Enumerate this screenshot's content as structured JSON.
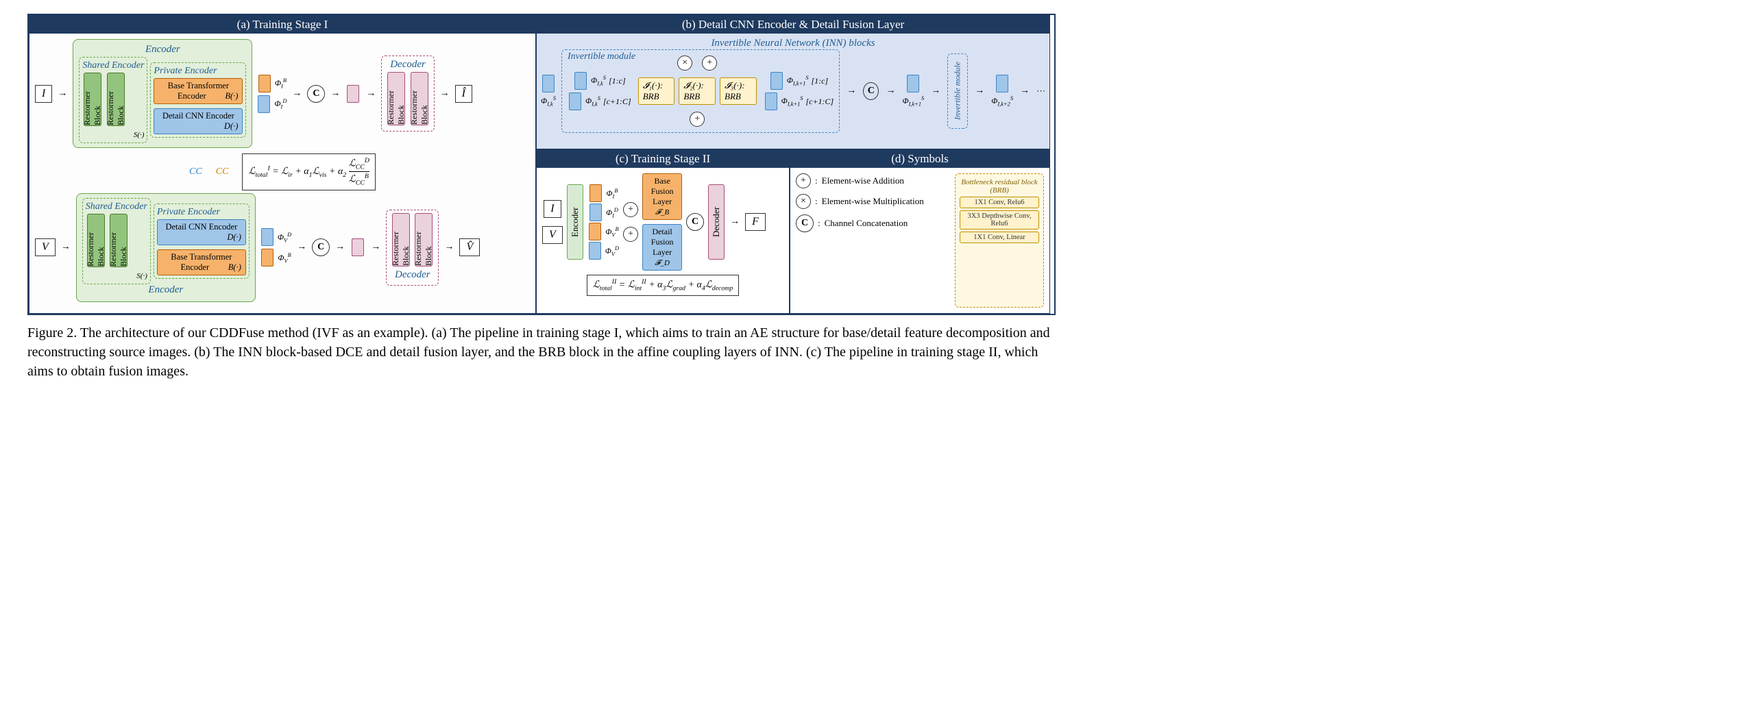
{
  "panels": {
    "a": {
      "title": "(a) Training Stage I",
      "encoder_label": "Encoder",
      "shared_encoder_label": "Shared Encoder",
      "private_encoder_label": "Private Encoder",
      "restormer": "Restormer Block",
      "bte": "Base Transformer Encoder",
      "bte_fn": "B(·)",
      "dce": "Detail CNN Encoder",
      "dce_fn": "D(·)",
      "shared_fn": "S(·)",
      "decoder_label": "Decoder",
      "input_I": "I",
      "input_V": "V",
      "output_Ihat": "Î",
      "output_Vhat": "V̂",
      "phi_B_I": "Φ_I^B",
      "phi_D_I": "Φ_I^D",
      "phi_B_V": "Φ_V^B",
      "phi_D_V": "Φ_V^D",
      "cc_label": "CC",
      "loss_I": "ℒ_total^I = ℒ_ir + α₁ℒ_vis + α₂ (ℒ_CC^D / ℒ_CC^B)"
    },
    "b": {
      "title": "(b) Detail CNN Encoder & Detail Fusion Layer",
      "inn_title": "Invertible Neural Network (INN) blocks",
      "inv_module": "Invertible module",
      "phi_in": "Φ_{I,k}^S",
      "phi_mid": "Φ_{I,k+1}^S",
      "phi_out": "Φ_{I,k+2}^S",
      "slice_top": "[1:c]",
      "slice_bot": "[c+1:C]",
      "brb1": "𝓘₁(·): BRB",
      "brb2": "𝓘₂(·): BRB",
      "brb3": "𝓘₃(·): BRB",
      "dots": "···"
    },
    "c": {
      "title": "(c) Training Stage II",
      "input_I": "I",
      "input_V": "V",
      "encoder": "Encoder",
      "decoder": "Decoder",
      "base_fusion": "Base Fusion Layer",
      "base_fn": "𝓕_B",
      "detail_fusion": "Detail Fusion Layer",
      "detail_fn": "𝓕_D",
      "output_F": "F",
      "phi_B_I": "Φ_I^B",
      "phi_D_I": "Φ_I^D",
      "phi_B_V": "Φ_V^B",
      "phi_D_V": "Φ_V^D",
      "loss_II": "ℒ_total^II = ℒ_int^II + α₃ℒ_grad + α₄ℒ_decomp"
    },
    "d": {
      "title": "(d) Symbols",
      "add": "Element-wise Addition",
      "mul": "Element-wise Multiplication",
      "concat": "Channel Concatenation",
      "brb_title": "Bottleneck residual block (BRB)",
      "layer1": "1X1 Conv, Relu6",
      "layer2": "3X3 Depthwise Conv, Relu6",
      "layer3": "1X1 Conv, Linear"
    }
  },
  "caption": {
    "lead": "Figure 2.",
    "text": "The architecture of our CDDFuse method (IVF as an example). (a) The pipeline in training stage I, which aims to train an AE structure for base/detail feature decomposition and reconstructing source images. (b) The INN block-based DCE and detail fusion layer, and the BRB block in the affine coupling layers of INN. (c) The pipeline in training stage II, which aims to obtain fusion images."
  },
  "symbols": {
    "concat": "C",
    "add": "+",
    "mul": "×",
    "arrow": "→"
  }
}
